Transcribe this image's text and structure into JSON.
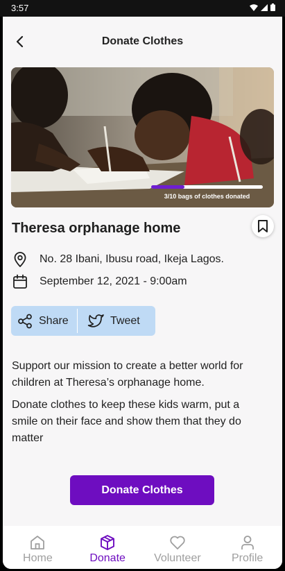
{
  "status_bar": {
    "time": "3:57"
  },
  "header": {
    "title": "Donate Clothes"
  },
  "hero": {
    "progress_label": "3/10 bags of clothes donated",
    "progress_value": 3,
    "progress_total": 10
  },
  "event": {
    "title": "Theresa orphanage home",
    "address": "No. 28 Ibani, Ibusu road, Ikeja Lagos.",
    "datetime": "September 12, 2021 - 9:00am"
  },
  "share": {
    "share_label": "Share",
    "tweet_label": "Tweet"
  },
  "description": {
    "paragraph1": "Support our mission to create a better world for children at Theresa’s orphanage home.",
    "paragraph2": "Donate clothes to keep these kids warm, put a smile on their face and show them that they do matter"
  },
  "cta": {
    "label": "Donate Clothes"
  },
  "nav": {
    "items": [
      {
        "label": "Home",
        "icon": "home-icon"
      },
      {
        "label": "Donate",
        "icon": "box-icon"
      },
      {
        "label": "Volunteer",
        "icon": "heart-icon"
      },
      {
        "label": "Profile",
        "icon": "user-icon"
      }
    ],
    "active_index": 1
  },
  "colors": {
    "accent": "#6e0dc0",
    "share_bg": "#bfdaf5",
    "page_bg": "#f7f6f7"
  }
}
